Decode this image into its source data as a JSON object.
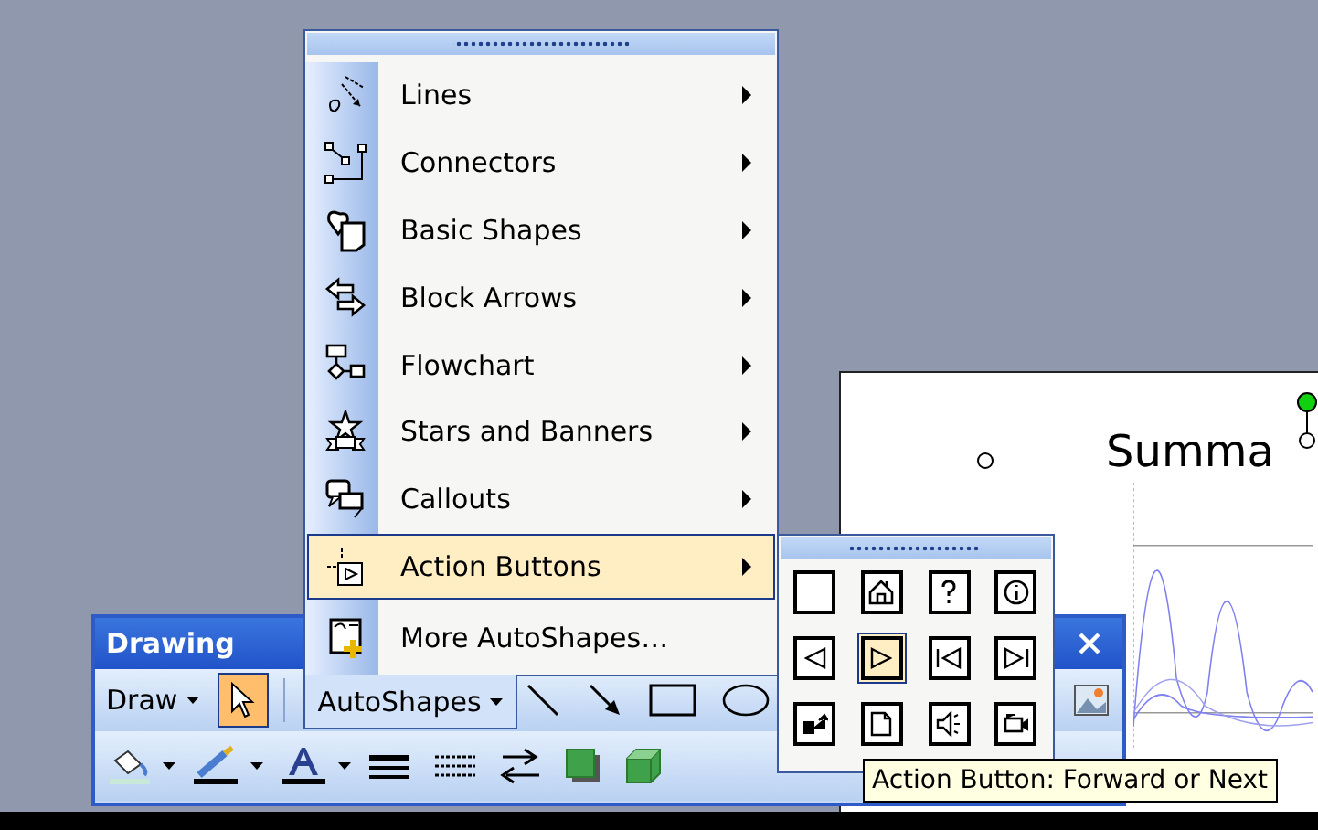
{
  "slide": {
    "title": "Summa"
  },
  "autoshapes_menu": {
    "items": [
      {
        "kind": "lines",
        "label": "Lines",
        "submenu": true,
        "selected": false
      },
      {
        "kind": "connectors",
        "label": "Connectors",
        "submenu": true,
        "selected": false
      },
      {
        "kind": "basic",
        "label": "Basic Shapes",
        "submenu": true,
        "selected": false
      },
      {
        "kind": "arrows",
        "label": "Block Arrows",
        "submenu": true,
        "selected": false
      },
      {
        "kind": "flowchart",
        "label": "Flowchart",
        "submenu": true,
        "selected": false
      },
      {
        "kind": "stars",
        "label": "Stars and Banners",
        "submenu": true,
        "selected": false
      },
      {
        "kind": "callouts",
        "label": "Callouts",
        "submenu": true,
        "selected": false
      },
      {
        "kind": "action",
        "label": "Action Buttons",
        "submenu": true,
        "selected": true
      },
      {
        "kind": "more",
        "label": "More AutoShapes…",
        "submenu": false,
        "selected": false
      }
    ]
  },
  "action_buttons": [
    {
      "kind": "custom",
      "selected": false
    },
    {
      "kind": "home",
      "selected": false
    },
    {
      "kind": "help",
      "selected": false
    },
    {
      "kind": "information",
      "selected": false
    },
    {
      "kind": "back",
      "selected": false
    },
    {
      "kind": "forward",
      "selected": true
    },
    {
      "kind": "beginning",
      "selected": false
    },
    {
      "kind": "end",
      "selected": false
    },
    {
      "kind": "return",
      "selected": false
    },
    {
      "kind": "document",
      "selected": false
    },
    {
      "kind": "sound",
      "selected": false
    },
    {
      "kind": "movie",
      "selected": false
    }
  ],
  "tooltip": "Action Button: Forward or Next",
  "toolbar": {
    "title": "Drawing",
    "draw_menu": "Draw",
    "select_tool": {
      "selected": true
    },
    "autoshapes": "AutoShapes"
  }
}
